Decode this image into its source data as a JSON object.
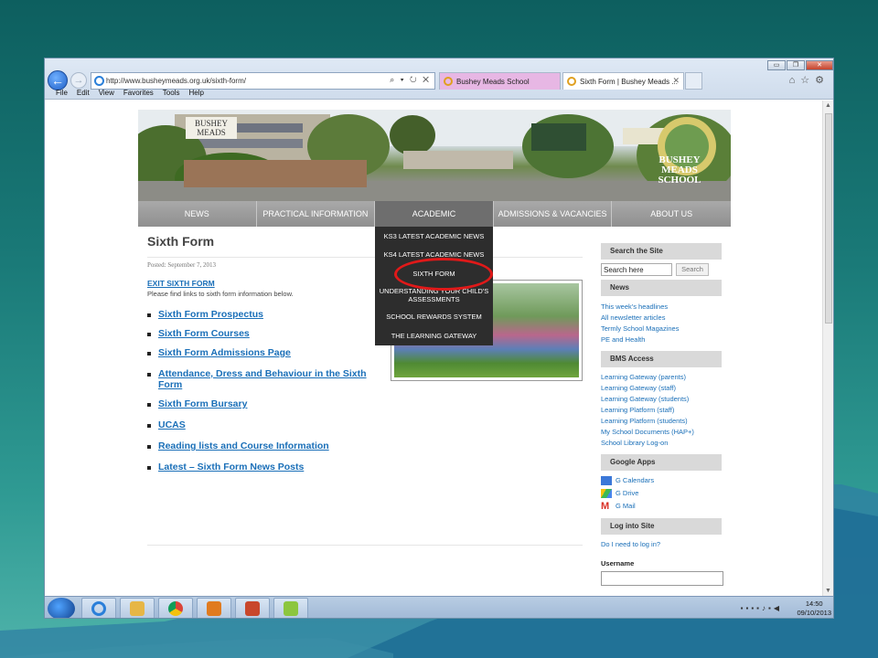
{
  "browser": {
    "url": "http://www.busheymeads.org.uk/sixth-form/",
    "address_tools": "⌕ ▾ ↻ ✕",
    "tabs": [
      {
        "label": "Bushey Meads School"
      },
      {
        "label": "Sixth Form | Bushey Meads ..."
      }
    ],
    "menu": [
      "File",
      "Edit",
      "View",
      "Favorites",
      "Tools",
      "Help"
    ]
  },
  "banner": {
    "logo_left": "BUSHEY MEADS",
    "logo_right": "BUSHEY MEADS SCHOOL"
  },
  "nav": {
    "items": [
      "NEWS",
      "PRACTICAL INFORMATION",
      "ACADEMIC",
      "ADMISSIONS & VACANCIES",
      "ABOUT US"
    ],
    "dropdown": [
      "KS3 LATEST ACADEMIC NEWS",
      "KS4 LATEST ACADEMIC NEWS",
      "SIXTH FORM",
      "UNDERSTANDING YOUR CHILD'S ASSESSMENTS",
      "SCHOOL REWARDS SYSTEM",
      "THE LEARNING GATEWAY"
    ]
  },
  "content": {
    "title": "Sixth Form",
    "posted": "Posted: September 7, 2013",
    "exit": "EXIT SIXTH FORM",
    "intro": "Please find links to sixth form information below.",
    "links": [
      "Sixth Form Prospectus",
      "Sixth Form Courses",
      "Sixth Form Admissions Page",
      "Attendance, Dress and Behaviour in the Sixth Form",
      "Sixth Form Bursary",
      "UCAS",
      "Reading lists and Course Information",
      "Latest – Sixth Form News Posts"
    ]
  },
  "sidebar": {
    "search_head": "Search the Site",
    "search_value": "Search here",
    "search_button": "Search",
    "news_head": "News",
    "news_links": [
      "This week's headlines",
      "All newsletter articles",
      "Termly School Magazines",
      "PE and Health"
    ],
    "bms_head": "BMS Access",
    "bms_links": [
      "Learning Gateway (parents)",
      "Learning Gateway (staff)",
      "Learning Gateway (students)",
      "Learning Platform (staff)",
      "Learning Platform (students)",
      "My School Documents (HAP+)",
      "School Library Log-on"
    ],
    "apps_head": "Google Apps",
    "apps": [
      "G Calendars",
      "G Drive",
      "G Mail"
    ],
    "login_head": "Log into Site",
    "login_link": "Do I need to log in?",
    "username_label": "Username"
  },
  "taskbar": {
    "time": "14:50",
    "date": "09/10/2013"
  },
  "colors": {
    "link": "#1a6fb8",
    "highlight_ring": "#e01919",
    "nav_bg": "#8f8f8f",
    "dropdown_bg": "#2d2d2d"
  }
}
